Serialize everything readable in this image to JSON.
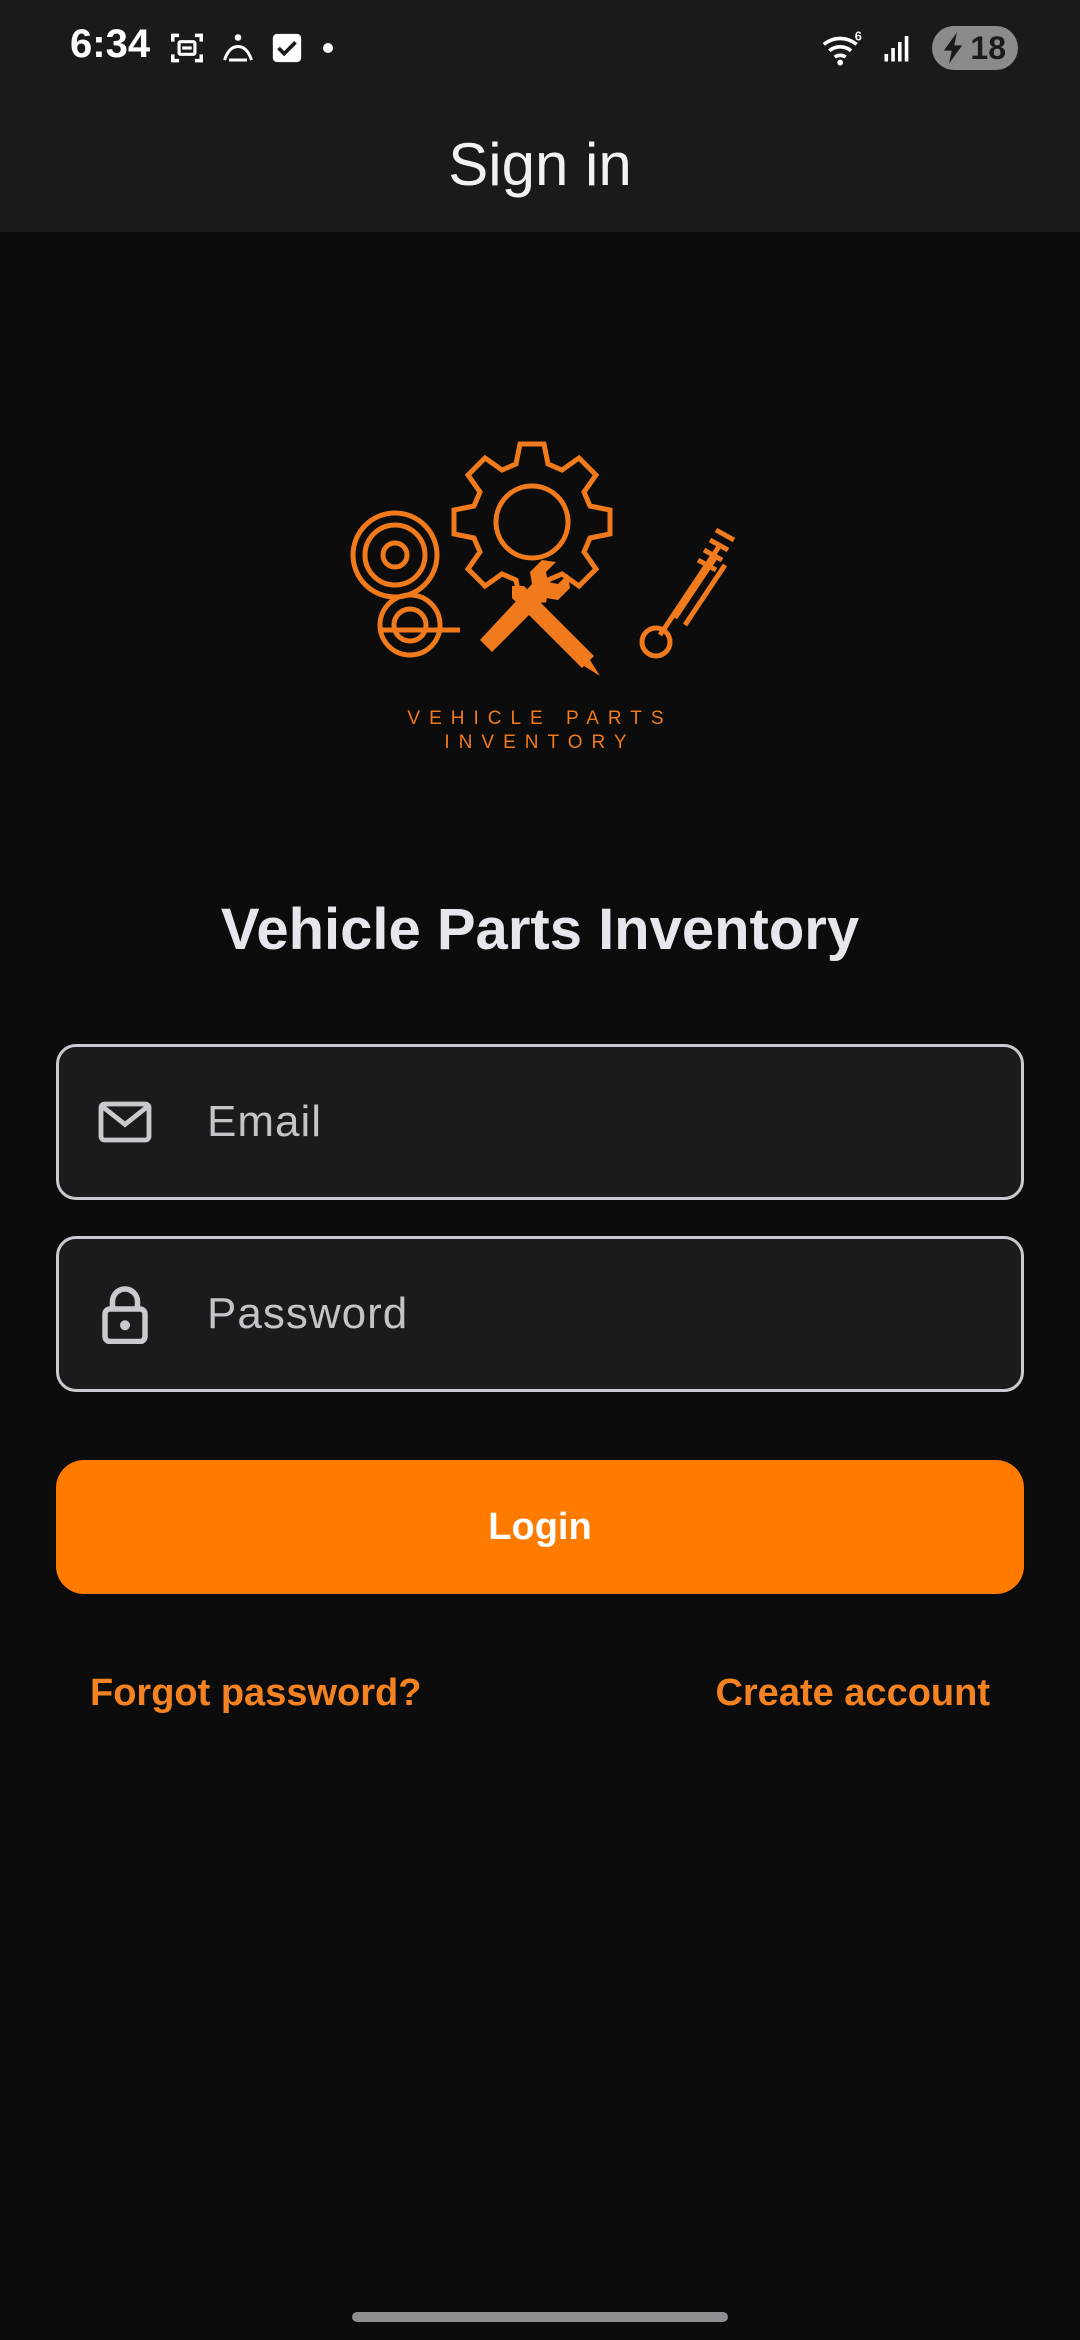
{
  "status_bar": {
    "time": "6:34",
    "battery_level": "18",
    "left_icons": [
      "screenshot-icon",
      "accessibility-icon",
      "check-box-icon",
      "dot-icon"
    ],
    "right_icons": [
      "wifi-icon",
      "signal-icon",
      "battery-icon"
    ]
  },
  "app_bar": {
    "title": "Sign in"
  },
  "logo": {
    "line1": "VEHICLE PARTS",
    "line2": "INVENTORY",
    "color": "#f07a1c"
  },
  "heading": "Vehicle Parts Inventory",
  "form": {
    "email": {
      "placeholder": "Email",
      "value": "",
      "icon": "mail-icon"
    },
    "password": {
      "placeholder": "Password",
      "value": "",
      "icon": "lock-icon"
    },
    "login_label": "Login"
  },
  "links": {
    "forgot": "Forgot password?",
    "create": "Create account"
  },
  "colors": {
    "accent": "#ff7b00",
    "link": "#f58220",
    "background": "#0c0c0d",
    "bar": "#1a1a1b"
  }
}
